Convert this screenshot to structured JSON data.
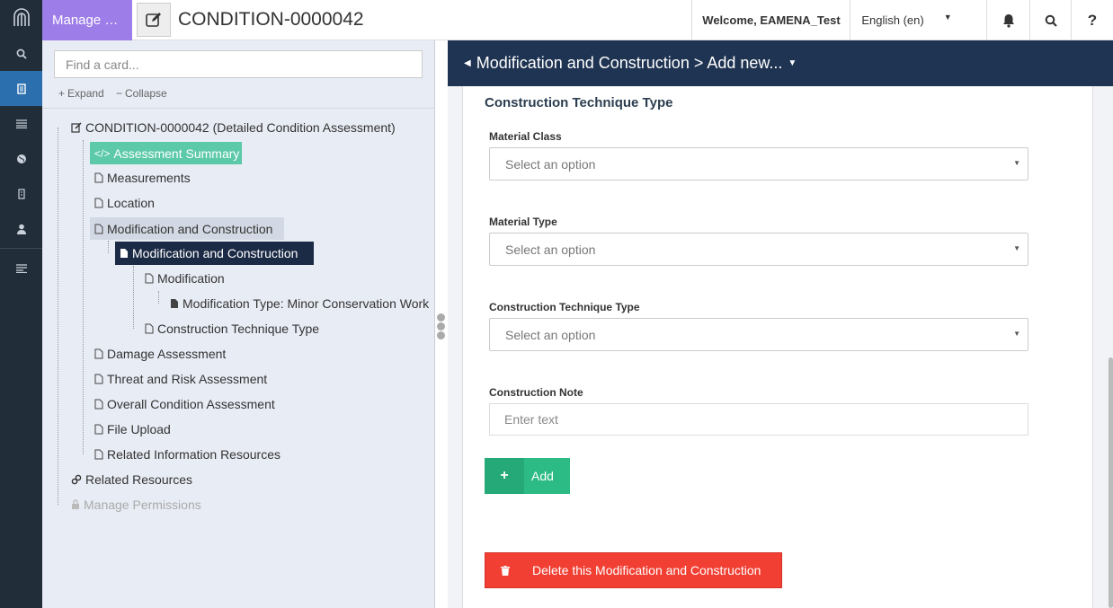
{
  "app": {
    "manage_label": "Manage …",
    "doc_title": "CONDITION-0000042"
  },
  "topbar": {
    "welcome": "Welcome, EAMENA_Test",
    "language": "English (en)",
    "help": "?"
  },
  "tree": {
    "search_placeholder": "Find a card...",
    "expand": "Expand",
    "collapse": "Collapse",
    "nodes": {
      "root": "CONDITION-0000042 (Detailed Condition Assessment)",
      "summary": "Assessment Summary",
      "measurements": "Measurements",
      "location": "Location",
      "modcon_group": "Modification and Construction",
      "modcon_card": "Modification and Construction",
      "modification": "Modification",
      "mod_type": "Modification Type: Minor Conservation Work",
      "construction_type": "Construction Technique Type",
      "damage": "Damage Assessment",
      "threat": "Threat and Risk Assessment",
      "overall": "Overall Condition Assessment",
      "file_upload": "File Upload",
      "related_info": "Related Information Resources",
      "related_resources": "Related Resources",
      "permissions": "Manage Permissions"
    }
  },
  "main": {
    "header": "Modification and Construction > Add new...",
    "section_title": "Construction Technique Type",
    "fields": {
      "material_class": {
        "label": "Material Class",
        "value": "Select an option"
      },
      "material_type": {
        "label": "Material Type",
        "value": "Select an option"
      },
      "technique_type": {
        "label": "Construction Technique Type",
        "value": "Select an option"
      },
      "note": {
        "label": "Construction Note",
        "placeholder": "Enter text"
      }
    },
    "add_label": "Add",
    "delete_label": "Delete this Modification and Construction"
  },
  "colors": {
    "rail": "#222d3a",
    "manage": "#9d7de8",
    "header": "#1f3452",
    "summary": "#5cc9a8",
    "add": "#2dbb85",
    "delete": "#f23f33"
  },
  "icons": [
    "arches-logo-icon",
    "search-icon",
    "resource-icon",
    "list-icon",
    "globe-icon",
    "bookmark-icon",
    "user-icon",
    "lines-icon",
    "edit-icon",
    "bell-icon",
    "question-icon",
    "plus-icon",
    "trash-icon",
    "file-icon",
    "code-icon",
    "link-icon",
    "lock-icon"
  ]
}
